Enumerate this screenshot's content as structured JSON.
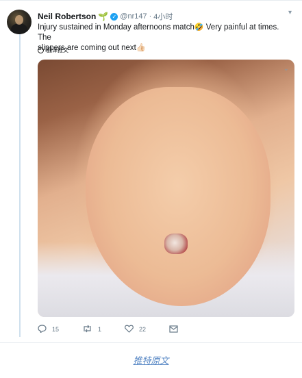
{
  "tweet": {
    "author_name": "Neil Robertson",
    "name_emoji": "🌱",
    "verified_icon": "verified-badge-icon",
    "handle": "@nr147",
    "separator": "·",
    "time": "4小时",
    "text_line1": "Injury sustained in Monday afternoons match",
    "laugh_emoji": "🤣",
    "text_line1_tail": " Very painful at times. The",
    "text_line2": "slippers are coming out next",
    "point_emoji": "👍🏻",
    "translate_label": "翻译推文",
    "menu_icon": "chevron-down-icon",
    "photo_alt": "heel-injury-photo"
  },
  "actions": {
    "reply": {
      "icon": "reply-icon",
      "count": "15"
    },
    "retweet": {
      "icon": "retweet-icon",
      "count": "1"
    },
    "like": {
      "icon": "heart-icon",
      "count": "22"
    },
    "message": {
      "icon": "envelope-icon"
    }
  },
  "footer": {
    "source_link": "推特原文"
  },
  "colors": {
    "accent": "#1da1f2",
    "link": "#5b8ac6",
    "muted_text": "#657786",
    "text": "#14171a"
  }
}
